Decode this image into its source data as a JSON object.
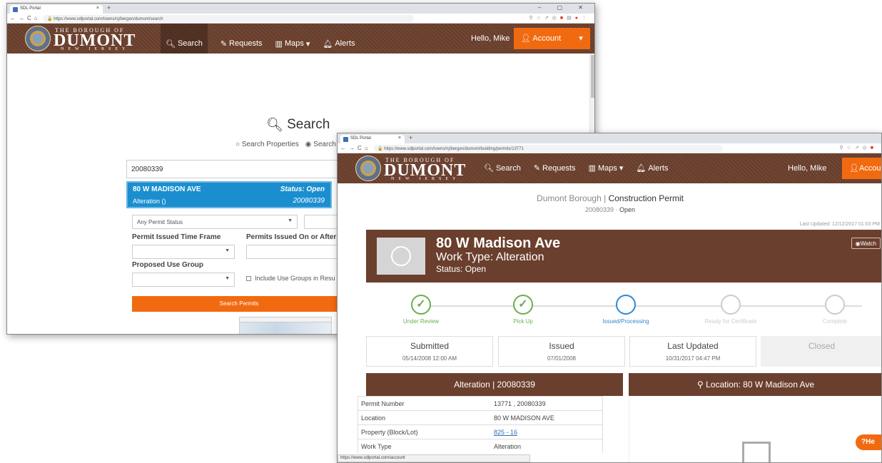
{
  "back_window": {
    "browser": {
      "tab_title": "SDL Portal",
      "url": "https://www.sdlportal.com/towns/nj/bergen/dumont/search",
      "window_controls": "–  ▢  ✕"
    },
    "header": {
      "logo_top": "THE BOROUGH OF",
      "logo_main": "DUMONT",
      "logo_bottom": "NEW JERSEY",
      "nav": [
        "Search",
        "Requests",
        "Maps",
        "Alerts"
      ],
      "hello": "Hello, Mike",
      "account": "Account"
    },
    "search": {
      "title": "Search",
      "radio_1": "Search Properties",
      "radio_2": "Search",
      "input_value": "20080339",
      "suggestion": {
        "address": "80 W MADISON AVE",
        "status": "Status: Open",
        "work": "Alteration ()",
        "number": "20080339"
      },
      "permit_status": "Any Permit Status",
      "label_timeframe": "Permit Issued Time Frame",
      "label_on_after": "Permits Issued On or After",
      "label_use_group": "Proposed Use Group",
      "include_use_groups": "Include Use Groups in Resu",
      "button": "Search Permits"
    }
  },
  "front_window": {
    "browser": {
      "tab_title": "SDL Portal",
      "url": "https://www.sdlportal.com/towns/nj/bergen/dumont/building/permits/13771"
    },
    "header": {
      "logo_top": "THE BOROUGH OF",
      "logo_main": "DUMONT",
      "logo_bottom": "NEW JERSEY",
      "nav": [
        "Search",
        "Requests",
        "Maps",
        "Alerts"
      ],
      "hello": "Hello, Mike",
      "account": "Account"
    },
    "breadcrumb": {
      "borough": "Dumont Borough",
      "separator": "|",
      "type": "Construction Permit",
      "permit_no": "20080339",
      "dash": "·",
      "status": "Open"
    },
    "last_updated": "Last Updated: 12/12/2017 01:03 PM",
    "hero": {
      "address": "80 W Madison Ave",
      "work_type": "Work Type: Alteration",
      "status": "Status: Open",
      "watch": "Watch"
    },
    "steps": [
      {
        "label": "Under Review",
        "state": "done"
      },
      {
        "label": "Pick Up",
        "state": "done"
      },
      {
        "label": "Issued/Processing",
        "state": "current"
      },
      {
        "label": "Ready for Certificate",
        "state": "pending"
      },
      {
        "label": "Complete",
        "state": "pending"
      }
    ],
    "dates": {
      "submitted_label": "Submitted",
      "submitted_value": "05/14/2008 12:00 AM",
      "issued_label": "Issued",
      "issued_value": "07/01/2008",
      "updated_label": "Last Updated",
      "updated_value": "10/31/2017 04:47 PM",
      "closed_label": "Closed"
    },
    "details_panel": {
      "title": "Alteration | 20080339",
      "rows": [
        {
          "key": "Permit Number",
          "value": "13771 , 20080339"
        },
        {
          "key": "Location",
          "value": "80 W MADISON AVE"
        },
        {
          "key": "Property (Block/Lot)",
          "value": "825 - 16"
        },
        {
          "key": "Work Type",
          "value": "Alteration"
        }
      ]
    },
    "location_panel": {
      "title": "Location: 80 W Madison Ave"
    },
    "help": "He",
    "status_url": "https://www.sdlportal.com/account"
  },
  "colors": {
    "brand_brown": "#6b3f2d",
    "accent_orange": "#f26a10",
    "suggest_blue": "#1b8ecf",
    "done_green": "#6ab04c",
    "current_blue": "#2f88d3"
  }
}
